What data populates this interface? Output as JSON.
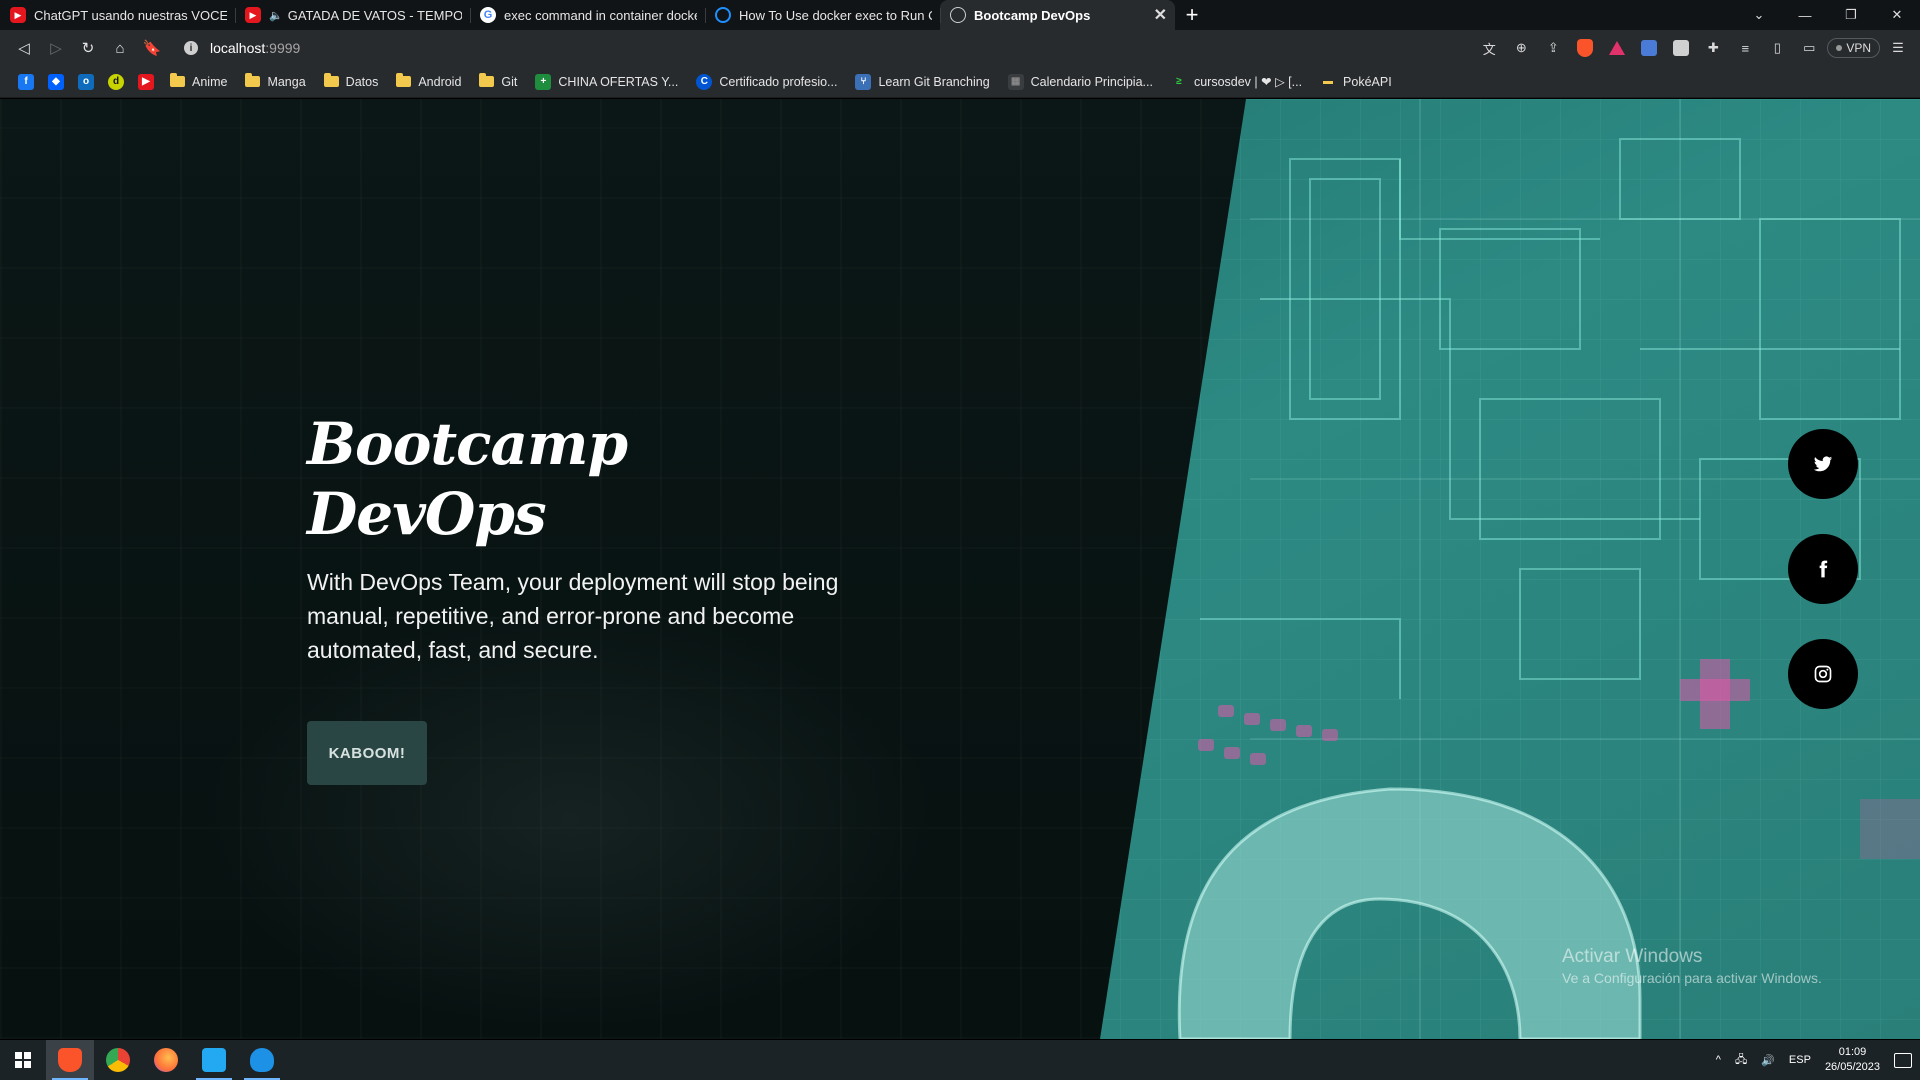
{
  "browser": {
    "tabs": [
      {
        "title": "ChatGPT usando nuestras VOCES CLO",
        "favicon": "youtube-icon",
        "muted": false
      },
      {
        "title": "GATADA DE VATOS - TEMPORADA",
        "favicon": "youtube-icon",
        "muted": true
      },
      {
        "title": "exec command in container docker ng",
        "favicon": "google-icon",
        "muted": false
      },
      {
        "title": "How To Use docker exec to Run Comm",
        "favicon": "digitalocean-icon",
        "muted": false
      },
      {
        "title": "Bootcamp DevOps",
        "favicon": "globe-icon",
        "active": true
      }
    ],
    "address": {
      "host": "localhost",
      "port": ":9999"
    },
    "vpn_label": "VPN",
    "bookmarks": [
      {
        "label": "Anime",
        "type": "folder"
      },
      {
        "label": "Manga",
        "type": "folder"
      },
      {
        "label": "Datos",
        "type": "folder"
      },
      {
        "label": "Android",
        "type": "folder"
      },
      {
        "label": "Git",
        "type": "folder"
      },
      {
        "label": "CHINA OFERTAS Y...",
        "type": "link"
      },
      {
        "label": "Certificado profesio...",
        "type": "link"
      },
      {
        "label": "Learn Git Branching",
        "type": "link"
      },
      {
        "label": "Calendario Principia...",
        "type": "link"
      },
      {
        "label": "cursosdev | ❤ ▷ [...",
        "type": "link"
      },
      {
        "label": "PokéAPI",
        "type": "link"
      }
    ]
  },
  "hero": {
    "title": "Bootcamp DevOps",
    "description": "With DevOps Team, your deployment will stop being manual, repetitive, and error-prone and become automated, fast, and secure.",
    "cta_label": "KABOOM!"
  },
  "social": [
    "twitter-icon",
    "facebook-icon",
    "instagram-icon"
  ],
  "watermark": {
    "title": "Activar Windows",
    "subtitle": "Ve a Configuración para activar Windows."
  },
  "taskbar": {
    "language": "ESP",
    "time": "01:09",
    "date": "26/05/2023"
  },
  "colors": {
    "accent": "#2a4644",
    "circuit": "#3aa39b"
  }
}
